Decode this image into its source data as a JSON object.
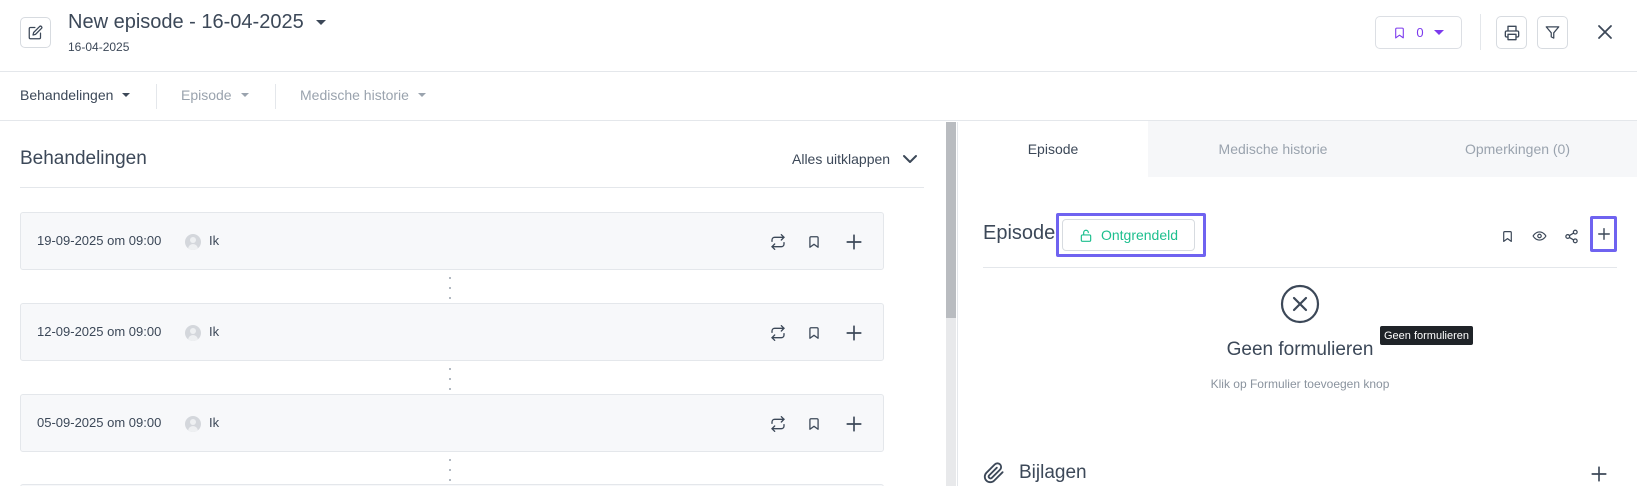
{
  "header": {
    "title": "New episode - 16-04-2025",
    "subtitle": "16-04-2025",
    "bookmark_count": "0",
    "colors": {
      "accent": "#7c3aed",
      "text": "#3c4858"
    }
  },
  "subnav": {
    "items": [
      {
        "label": "Behandelingen",
        "active": true
      },
      {
        "label": "Episode",
        "active": false
      },
      {
        "label": "Medische historie",
        "active": false
      }
    ]
  },
  "left": {
    "title": "Behandelingen",
    "expand_all": "Alles uitklappen",
    "cards": [
      {
        "date": "19-09-2025 om 09:00",
        "user": "Ik"
      },
      {
        "date": "12-09-2025 om 09:00",
        "user": "Ik"
      },
      {
        "date": "05-09-2025 om 09:00",
        "user": "Ik"
      }
    ]
  },
  "right": {
    "tabs": [
      {
        "label": "Episode",
        "active": true
      },
      {
        "label": "Medische historie",
        "active": false
      },
      {
        "label": "Opmerkingen (0)",
        "active": false
      }
    ],
    "title": "Episode",
    "lock_label": "Ontgrendeld",
    "lock_color": "#1dbf8e",
    "highlight_color": "#6f63f0",
    "empty_title": "Geen formulieren",
    "empty_hint": "Klik op Formulier toevoegen knop",
    "tooltip": "Geen formulieren",
    "attachments_label": "Bijlagen"
  }
}
